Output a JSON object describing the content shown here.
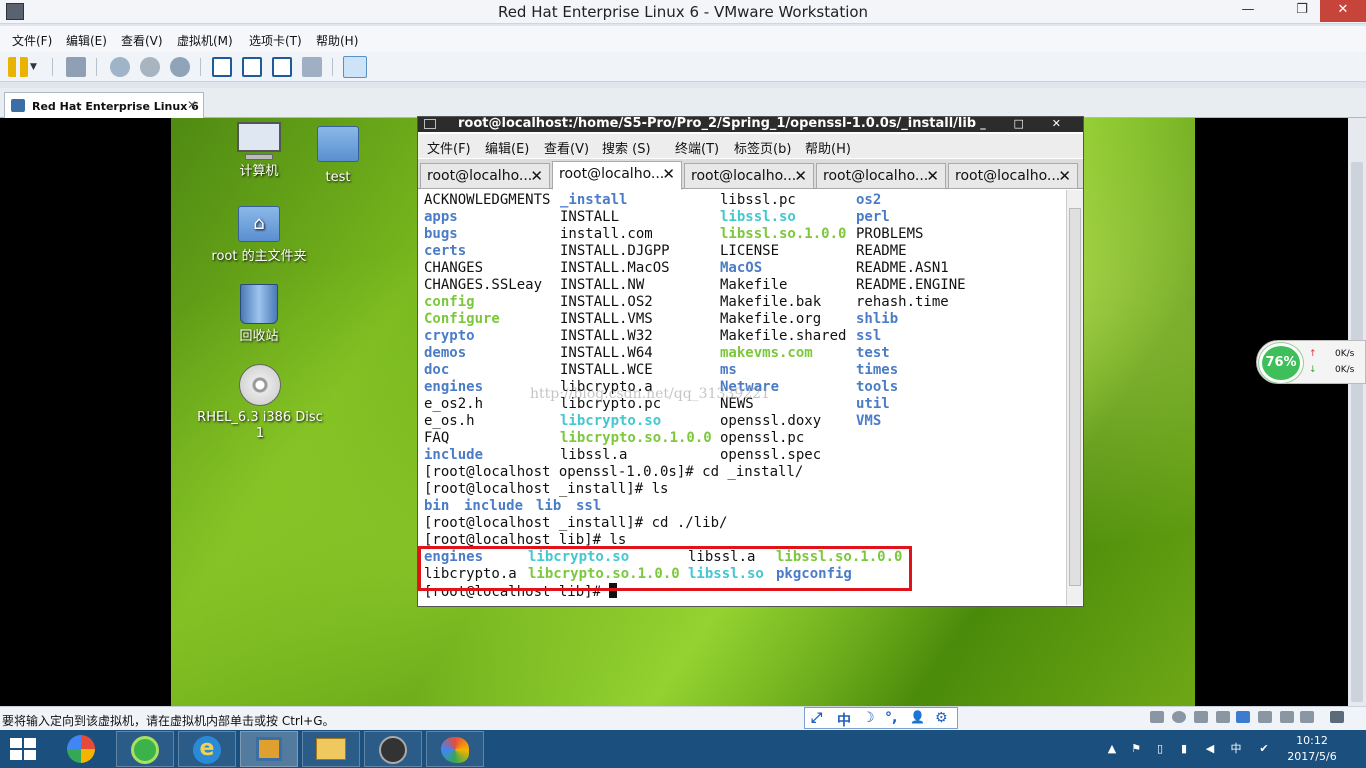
{
  "window": {
    "title": "Red Hat Enterprise Linux 6 - VMware Workstation",
    "min": "—",
    "max": "❐",
    "close": "✕"
  },
  "menubar": [
    "文件(F)",
    "编辑(E)",
    "查看(V)",
    "虚拟机(M)",
    "选项卡(T)",
    "帮助(H)"
  ],
  "vm_tab": {
    "label": "Red Hat Enterprise Linux 6",
    "close": "✕"
  },
  "desktop_icons": [
    {
      "label": "计算机",
      "icon": "computer-icon"
    },
    {
      "label": "test",
      "icon": "folder-icon"
    },
    {
      "label": "root 的主文件夹",
      "icon": "home-folder-icon"
    },
    {
      "label": "回收站",
      "icon": "trash-icon"
    },
    {
      "label": "RHEL_6.3 i386 Disc 1",
      "icon": "dvd-icon"
    }
  ],
  "terminal": {
    "title": "root@localhost:/home/S5-Pro/Pro_2/Spring_1/openssl-1.0.0s/_install/lib",
    "title_buttons": "_ □ ✕",
    "menu": [
      "文件(F)",
      "编辑(E)",
      "查看(V)",
      "搜索 (S)",
      "终端(T)",
      "标签页(b)",
      "帮助(H)"
    ],
    "tabs": [
      "root@localho...",
      "root@localho...",
      "root@localho...",
      "root@localho...",
      "root@localho..."
    ],
    "active_tab": 1,
    "tab_close": "✕",
    "listing": [
      [
        [
          "ACKNOWLEDGMENTS",
          ""
        ],
        [
          "_install",
          "dir"
        ],
        [
          "libssl.pc",
          ""
        ],
        [
          "os2",
          "dir"
        ]
      ],
      [
        [
          "apps",
          "dir"
        ],
        [
          "INSTALL",
          ""
        ],
        [
          "libssl.so",
          "lnk"
        ],
        [
          "perl",
          "dir"
        ]
      ],
      [
        [
          "bugs",
          "dir"
        ],
        [
          "install.com",
          ""
        ],
        [
          "libssl.so.1.0.0",
          "exe"
        ],
        [
          "PROBLEMS",
          ""
        ]
      ],
      [
        [
          "certs",
          "dir"
        ],
        [
          "INSTALL.DJGPP",
          ""
        ],
        [
          "LICENSE",
          ""
        ],
        [
          "README",
          ""
        ]
      ],
      [
        [
          "CHANGES",
          ""
        ],
        [
          "INSTALL.MacOS",
          ""
        ],
        [
          "MacOS",
          "dir"
        ],
        [
          "README.ASN1",
          ""
        ]
      ],
      [
        [
          "CHANGES.SSLeay",
          ""
        ],
        [
          "INSTALL.NW",
          ""
        ],
        [
          "Makefile",
          ""
        ],
        [
          "README.ENGINE",
          ""
        ]
      ],
      [
        [
          "config",
          "exe"
        ],
        [
          "INSTALL.OS2",
          ""
        ],
        [
          "Makefile.bak",
          ""
        ],
        [
          "rehash.time",
          ""
        ]
      ],
      [
        [
          "Configure",
          "exe"
        ],
        [
          "INSTALL.VMS",
          ""
        ],
        [
          "Makefile.org",
          ""
        ],
        [
          "shlib",
          "dir"
        ]
      ],
      [
        [
          "crypto",
          "dir"
        ],
        [
          "INSTALL.W32",
          ""
        ],
        [
          "Makefile.shared",
          ""
        ],
        [
          "ssl",
          "dir"
        ]
      ],
      [
        [
          "demos",
          "dir"
        ],
        [
          "INSTALL.W64",
          ""
        ],
        [
          "makevms.com",
          "exe"
        ],
        [
          "test",
          "dir"
        ]
      ],
      [
        [
          "doc",
          "dir"
        ],
        [
          "INSTALL.WCE",
          ""
        ],
        [
          "ms",
          "dir"
        ],
        [
          "times",
          "dir"
        ]
      ],
      [
        [
          "engines",
          "dir"
        ],
        [
          "libcrypto.a",
          ""
        ],
        [
          "Netware",
          "dir"
        ],
        [
          "tools",
          "dir"
        ]
      ],
      [
        [
          "e_os2.h",
          ""
        ],
        [
          "libcrypto.pc",
          ""
        ],
        [
          "NEWS",
          ""
        ],
        [
          "util",
          "dir"
        ]
      ],
      [
        [
          "e_os.h",
          ""
        ],
        [
          "libcrypto.so",
          "lnk"
        ],
        [
          "openssl.doxy",
          ""
        ],
        [
          "VMS",
          "dir"
        ]
      ],
      [
        [
          "FAQ",
          ""
        ],
        [
          "libcrypto.so.1.0.0",
          "exe"
        ],
        [
          "openssl.pc",
          ""
        ]
      ],
      [
        [
          "include",
          "dir"
        ],
        [
          "libssl.a",
          ""
        ],
        [
          "openssl.spec",
          ""
        ]
      ]
    ],
    "cmd1": "[root@localhost openssl-1.0.0s]# cd _install/",
    "cmd2": "[root@localhost _install]# ls",
    "ls_install": [
      [
        "bin",
        "dir"
      ],
      [
        "include",
        "dir"
      ],
      [
        "lib",
        "dir"
      ],
      [
        "ssl",
        "dir"
      ]
    ],
    "cmd3": "[root@localhost _install]# cd ./lib/",
    "cmd4": "[root@localhost lib]# ls",
    "ls_lib": [
      [
        [
          "engines",
          "dir"
        ],
        [
          "libcrypto.so",
          "lnk"
        ],
        [
          "libssl.a",
          ""
        ],
        [
          "libssl.so.1.0.0",
          "exe"
        ]
      ],
      [
        [
          "libcrypto.a",
          ""
        ],
        [
          "libcrypto.so.1.0.0",
          "exe"
        ],
        [
          "libssl.so",
          "lnk"
        ],
        [
          "pkgconfig",
          "dir"
        ]
      ]
    ],
    "prompt": "[root@localhost lib]# ",
    "watermark": "http://blog.csdn.net/qq_31339221"
  },
  "net_widget": {
    "percent": "76%",
    "up_icon": "↑",
    "down_icon": "↓",
    "up": "0K/s",
    "down": "0K/s"
  },
  "status": {
    "message": "要将输入定向到该虚拟机，请在虚拟机内部单击或按 Ctrl+G。"
  },
  "ime": [
    "⤢",
    "中",
    "☽",
    "°,",
    "👤",
    "⚙"
  ],
  "tray": [
    "▲",
    "⚑",
    "▯",
    "▮",
    "◀",
    "中",
    "✔"
  ],
  "clock": {
    "time": "10:12",
    "date": "2017/5/6"
  },
  "colors": {
    "dir": "#4a7cc8",
    "exe": "#7cc83c",
    "lnk": "#44c8d0",
    "highlight": "#e0121a",
    "taskbar": "#1a4f7e"
  }
}
